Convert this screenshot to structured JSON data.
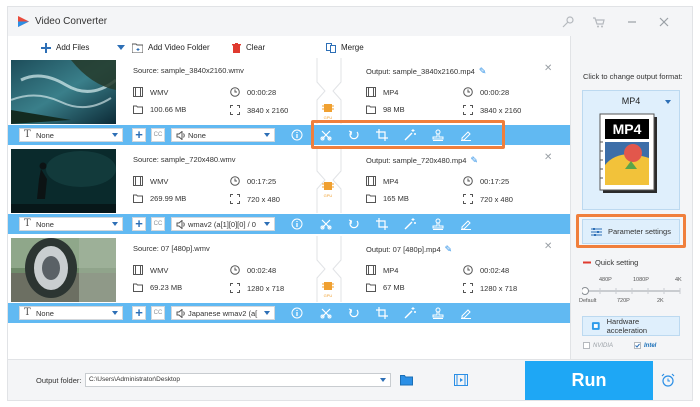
{
  "app": {
    "title": "Video Converter",
    "accent": "#1ea7f5",
    "highlight": "#f07f3c",
    "icons": [
      "app-logo-icon",
      "key-icon",
      "cart-icon",
      "minimize-icon",
      "close-icon"
    ]
  },
  "toolbar": {
    "add_files": "Add Files",
    "add_video_folder": "Add Video Folder",
    "clear": "Clear",
    "merge": "Merge"
  },
  "items": [
    {
      "source": "Source: sample_3840x2160.wmv",
      "output": "Output: sample_3840x2160.mp4",
      "src_format": "WMV",
      "src_duration": "00:00:28",
      "src_size": "100.66 MB",
      "src_res": "3840 x 2160",
      "out_format": "MP4",
      "out_duration": "00:00:28",
      "out_size": "98 MB",
      "out_res": "3840 x 2160",
      "subtitle": "None",
      "audio": "None",
      "gpu_label": "GPU"
    },
    {
      "source": "Source: sample_720x480.wmv",
      "output": "Output: sample_720x480.mp4",
      "src_format": "WMV",
      "src_duration": "00:17:25",
      "src_size": "269.99 MB",
      "src_res": "720 x 480",
      "out_format": "MP4",
      "out_duration": "00:17:25",
      "out_size": "165 MB",
      "out_res": "720 x 480",
      "subtitle": "None",
      "audio": "wmav2 (a[1][0][0] / 0",
      "gpu_label": "GPU"
    },
    {
      "source": "Source: 07 [480p].wmv",
      "output": "Output: 07 [480p].mp4",
      "src_format": "WMV",
      "src_duration": "00:02:48",
      "src_size": "69.23 MB",
      "src_res": "1280 x 718",
      "out_format": "MP4",
      "out_duration": "00:02:48",
      "out_size": "67 MB",
      "out_res": "1280 x 718",
      "subtitle": "None",
      "audio": "Japanese wmav2 (a[",
      "gpu_label": "GPU"
    }
  ],
  "right_panel": {
    "change_format_label": "Click to change output format:",
    "format": "MP4",
    "parameter_settings": "Parameter settings",
    "quick_setting": "Quick setting",
    "quality_top": [
      "480P",
      "1080P",
      "4K"
    ],
    "quality_bottom": [
      "Default",
      "720P",
      "2K"
    ],
    "quality_level": 0,
    "hardware_acceleration": "Hardware acceleration",
    "nvidia": "NVIDIA",
    "intel": "Intel"
  },
  "bottom": {
    "output_folder_label": "Output folder:",
    "output_folder_path": "C:\\Users\\Administrator\\Desktop",
    "run": "Run"
  }
}
